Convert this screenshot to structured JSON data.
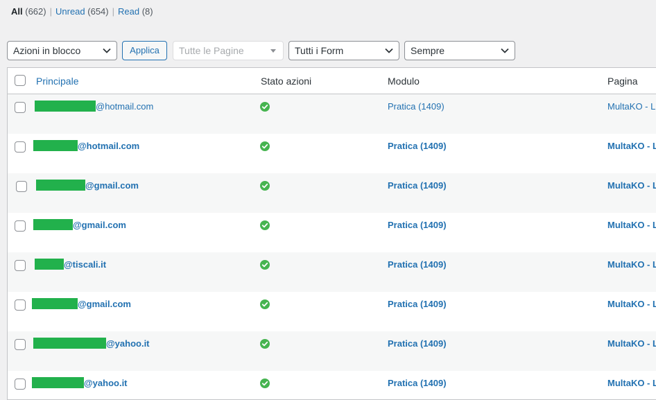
{
  "filters": {
    "all_label": "All",
    "all_count": "(662)",
    "unread_label": "Unread",
    "unread_count": "(654)",
    "read_label": "Read",
    "read_count": "(8)",
    "separator": "|"
  },
  "toolbar": {
    "bulk_actions": "Azioni in blocco",
    "apply": "Applica",
    "pages_select": "Tutte le Pagine",
    "forms_select": "Tutti i Form",
    "date_select": "Sempre"
  },
  "table": {
    "columns": {
      "principale": "Principale",
      "stato": "Stato azioni",
      "modulo": "Modulo",
      "pagina": "Pagina"
    },
    "rows": [
      {
        "email": "@hotmail.com",
        "modulo": "Pratica (1409)",
        "pagina": "MultaKO - LI",
        "read": true
      },
      {
        "email": "@hotmail.com",
        "modulo": "Pratica (1409)",
        "pagina": "MultaKO - L",
        "read": false
      },
      {
        "email": "@gmail.com",
        "modulo": "Pratica (1409)",
        "pagina": "MultaKO - L",
        "read": false
      },
      {
        "email": "@gmail.com",
        "modulo": "Pratica (1409)",
        "pagina": "MultaKO - L",
        "read": false
      },
      {
        "email": "@tiscali.it",
        "modulo": "Pratica (1409)",
        "pagina": "MultaKO - L",
        "read": false
      },
      {
        "email": "@gmail.com",
        "modulo": "Pratica (1409)",
        "pagina": "MultaKO - L",
        "read": false
      },
      {
        "email": "@yahoo.it",
        "modulo": "Pratica (1409)",
        "pagina": "MultaKO - L",
        "read": false
      },
      {
        "email": "@yahoo.it",
        "modulo": "Pratica (1409)",
        "pagina": "MultaKO - L",
        "read": false
      }
    ]
  },
  "colors": {
    "link": "#2271b1",
    "status_check": "#46b450",
    "redaction": "#22b14c"
  },
  "icons": {
    "status": "check-circle-icon",
    "dropdown": "chevron-down-icon"
  }
}
